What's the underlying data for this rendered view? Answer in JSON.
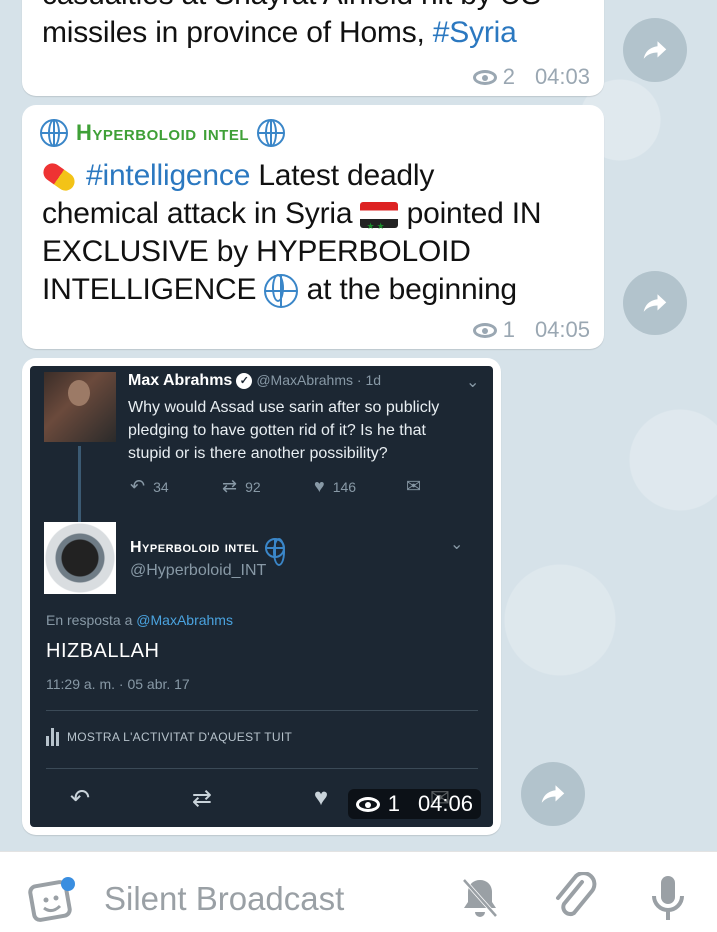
{
  "messages": [
    {
      "text_line1": "casualties at Shayrat Airfield hit by US",
      "text_line2": "missiles in province of Homs, ",
      "hashtag": "#Syria",
      "views": "2",
      "time": "04:03"
    },
    {
      "channel_name": "Hyperboloid intel",
      "hashtag": "#intelligence",
      "text_a": " Latest deadly",
      "text_b": "chemical attack in Syria",
      "text_c": " pointed IN",
      "text_d": "EXCLUSIVE by HYPERBOLOID",
      "text_e": "INTELLIGENCE",
      "text_f": " at the beginning",
      "views": "1",
      "time": "04:05"
    },
    {
      "views": "1",
      "time": "04:06",
      "tweet": {
        "author1_name": "Max Abrahms",
        "author1_handle": "@MaxAbrahms · 1d",
        "author1_text": "Why would Assad use sarin after so publicly pledging to have gotten rid of it? Is he that stupid or is there another possibility?",
        "replies": "34",
        "retweets": "92",
        "likes": "146",
        "author2_name": "Hyperboloid intel",
        "author2_handle": "@Hyperboloid_INT",
        "reply_prefix": "En resposta a ",
        "reply_to": "@MaxAbrahms",
        "reply_text": "HIZBALLAH",
        "reply_time": "11:29 a. m. · 05 abr. 17",
        "activity_label": "MOSTRA L'ACTIVITAT D'AQUEST TUIT"
      }
    }
  ],
  "composer": {
    "placeholder": "Silent Broadcast"
  },
  "colors": {
    "hashtag": "#2b78c0",
    "channel_name": "#3fa037",
    "meta": "#9aa7b2",
    "tweet_bg": "#1c2733"
  }
}
